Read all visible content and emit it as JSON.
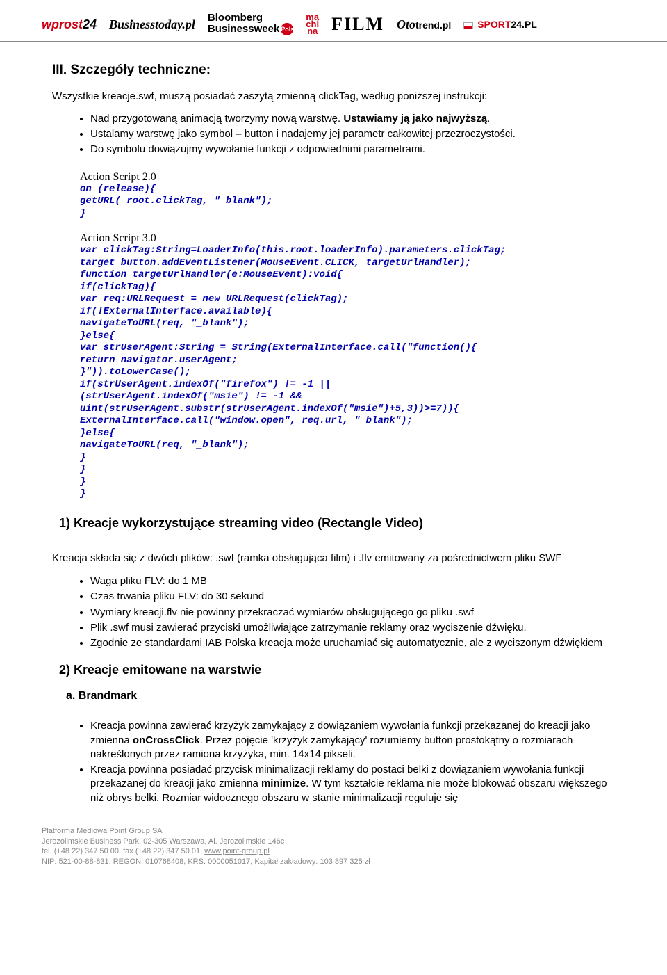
{
  "header_logos": {
    "wprost_w": "wprost",
    "wprost_24": "24",
    "bt": "Businesstoday.pl",
    "bb1": "Bloomberg",
    "bb2": "Businessweek",
    "bb_dot": "Polska",
    "mach1": "ma",
    "mach2": "chi",
    "mach3": "na",
    "film": "FILM",
    "trend_o": "Oto",
    "trend_t": "trend.pl",
    "sport_b": "SPORT",
    "sport_24": "24",
    "sport_pl": ".PL"
  },
  "section_title": "III.  Szczegóły techniczne:",
  "intro": "Wszystkie kreacje.swf, muszą posiadać zaszytą zmienną clickTag, według poniższej instrukcji:",
  "bullets_a": [
    "Nad przygotowaną animacją tworzymy nową warstwę. <b>Ustawiamy ją jako najwyższą</b>.",
    "Ustalamy warstwę jako symbol – button i nadajemy jej parametr całkowitej przezroczystości.",
    "Do symbolu dowiązujmy wywołanie funkcji z odpowiednimi parametrami."
  ],
  "as2_label": "Action Script 2.0",
  "as2_code": "on (release){\ngetURL(_root.clickTag, \"_blank\");\n}",
  "as3_label": "Action Script 3.0",
  "as3_code": "var clickTag:String=LoaderInfo(this.root.loaderInfo).parameters.clickTag;\ntarget_button.addEventListener(MouseEvent.CLICK, targetUrlHandler);\nfunction targetUrlHandler(e:MouseEvent):void{\nif(clickTag){\nvar req:URLRequest = new URLRequest(clickTag);\nif(!ExternalInterface.available){\nnavigateToURL(req, \"_blank\");\n}else{\nvar strUserAgent:String = String(ExternalInterface.call(\"function(){\nreturn navigator.userAgent;\n}\")).toLowerCase();\nif(strUserAgent.indexOf(\"firefox\") != -1 ||\n(strUserAgent.indexOf(\"msie\") != -1 &&\nuint(strUserAgent.substr(strUserAgent.indexOf(\"msie\")+5,3))>=7)){\nExternalInterface.call(\"window.open\", req.url, \"_blank\");\n}else{\nnavigateToURL(req, \"_blank\");\n}\n}\n}\n}",
  "h_1": "1)  Kreacje wykorzystujące streaming video (Rectangle Video)",
  "para_1": "Kreacja składa się z dwóch plików: .swf (ramka obsługująca film) i .flv  emitowany za pośrednictwem pliku SWF",
  "bullets_b": [
    "Waga pliku FLV: do 1 MB",
    "Czas trwania pliku FLV: do 30 sekund",
    "Wymiary kreacji.flv nie powinny przekraczać wymiarów obsługującego go pliku .swf",
    "Plik .swf musi zawierać przyciski umożliwiające zatrzymanie reklamy oraz wyciszenie dźwięku.",
    "Zgodnie ze standardami IAB Polska kreacja może uruchamiać się automatycznie, ale z wyciszonym dźwiękiem"
  ],
  "h_2": "2)  Kreacje emitowane na warstwie",
  "h_2a": "a.  Brandmark",
  "bullets_c": [
    "Kreacja powinna zawierać krzyżyk zamykający z dowiązaniem wywołania funkcji przekazanej do kreacji jako zmienna <b>onCrossClick</b>. Przez pojęcie 'krzyżyk zamykający' rozumiemy button prostokątny o rozmiarach nakreślonych przez ramiona krzyżyka, min. 14x14 pikseli.",
    "Kreacja powinna posiadać przycisk minimalizacji reklamy do postaci belki z dowiązaniem wywołania funkcji przekazanej do kreacji jako zmienna <b>minimize</b>. W tym kształcie reklama nie może blokować obszaru większego niż obrys belki. Rozmiar widocznego obszaru w stanie minimalizacji reguluje się"
  ],
  "footer": {
    "l1": "Platforma Mediowa Point Group SA",
    "l2": "Jerozolimskie Business Park, 02-305 Warszawa, Al. Jerozolimskie 146c",
    "l3_a": "tel. (+48 22) 347 50 00, fax (+48 22) 347 50 01, ",
    "l3_link": "www.point-group.pl",
    "l4": "NIP: 521-00-88-831, REGON: 010768408, KRS: 0000051017, Kapitał zakładowy: 103 897 325 zł"
  }
}
